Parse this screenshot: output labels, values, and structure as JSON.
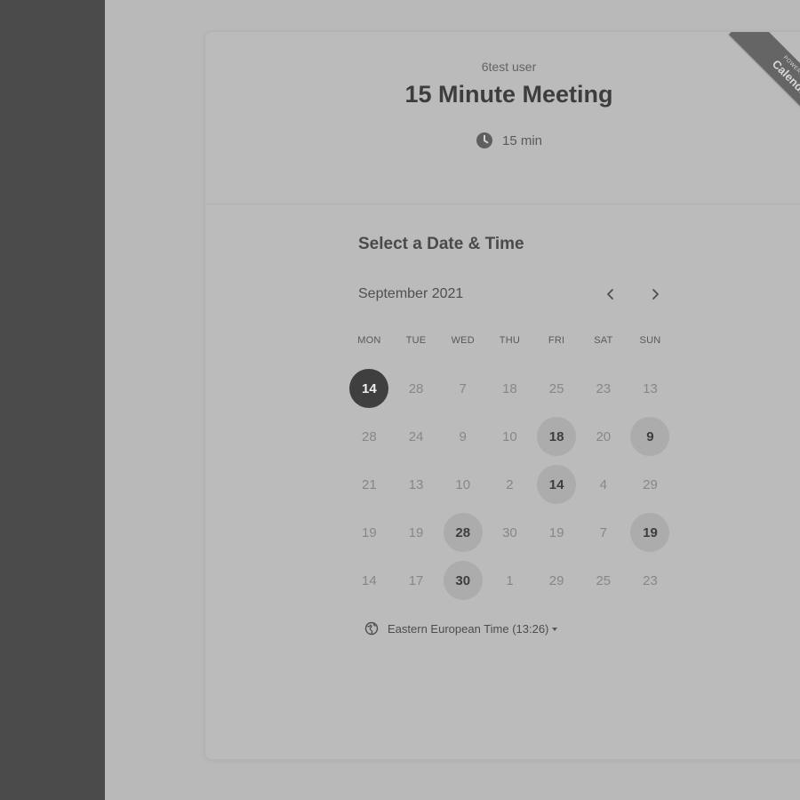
{
  "host": {
    "name": "6test user"
  },
  "event": {
    "title": "15 Minute Meeting",
    "duration": "15 min"
  },
  "ribbon": {
    "small": "Powered by",
    "brand": "Calendly"
  },
  "picker": {
    "title": "Select a Date & Time",
    "month": "September 2021",
    "weekdays": [
      "MON",
      "TUE",
      "WED",
      "THU",
      "FRI",
      "SAT",
      "SUN"
    ],
    "weeks": [
      [
        {
          "n": "14",
          "state": "selected"
        },
        {
          "n": "28",
          "state": "disabled"
        },
        {
          "n": "7",
          "state": "disabled"
        },
        {
          "n": "18",
          "state": "disabled"
        },
        {
          "n": "25",
          "state": "disabled"
        },
        {
          "n": "23",
          "state": "disabled"
        },
        {
          "n": "13",
          "state": "disabled"
        }
      ],
      [
        {
          "n": "28",
          "state": "disabled"
        },
        {
          "n": "24",
          "state": "disabled"
        },
        {
          "n": "9",
          "state": "disabled"
        },
        {
          "n": "10",
          "state": "disabled"
        },
        {
          "n": "18",
          "state": "available"
        },
        {
          "n": "20",
          "state": "disabled"
        },
        {
          "n": "9",
          "state": "available"
        }
      ],
      [
        {
          "n": "21",
          "state": "disabled"
        },
        {
          "n": "13",
          "state": "disabled"
        },
        {
          "n": "10",
          "state": "disabled"
        },
        {
          "n": "2",
          "state": "disabled"
        },
        {
          "n": "14",
          "state": "available"
        },
        {
          "n": "4",
          "state": "disabled"
        },
        {
          "n": "29",
          "state": "disabled"
        }
      ],
      [
        {
          "n": "19",
          "state": "disabled"
        },
        {
          "n": "19",
          "state": "disabled"
        },
        {
          "n": "28",
          "state": "available"
        },
        {
          "n": "30",
          "state": "disabled"
        },
        {
          "n": "19",
          "state": "disabled"
        },
        {
          "n": "7",
          "state": "disabled"
        },
        {
          "n": "19",
          "state": "available"
        }
      ],
      [
        {
          "n": "14",
          "state": "disabled"
        },
        {
          "n": "17",
          "state": "disabled"
        },
        {
          "n": "30",
          "state": "available"
        },
        {
          "n": "1",
          "state": "disabled"
        },
        {
          "n": "29",
          "state": "disabled"
        },
        {
          "n": "25",
          "state": "disabled"
        },
        {
          "n": "23",
          "state": "disabled"
        }
      ]
    ]
  },
  "timezone": {
    "label": "Eastern European Time (13:26)"
  },
  "icons": {
    "clock": "clock-icon",
    "globe": "globe-icon",
    "prev": "chevron-left-icon",
    "next": "chevron-right-icon",
    "caret": "caret-down-icon"
  },
  "colors": {
    "sidebar": "#4b4b4b",
    "background": "#b9b9b9",
    "selected_day": "#3f3f3f",
    "available_day": "#acacac"
  }
}
